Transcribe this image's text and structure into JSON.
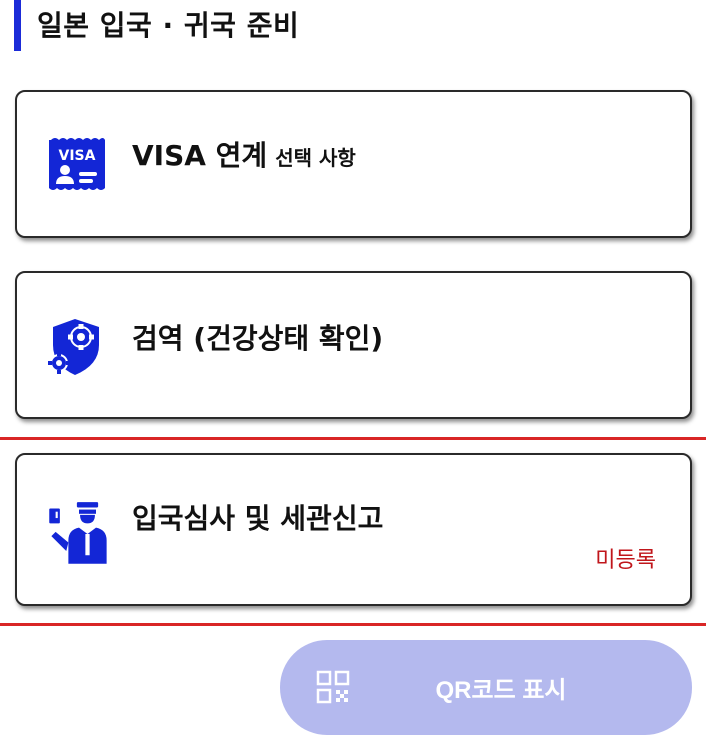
{
  "section": {
    "title": "일본 입국 · 귀국 준비"
  },
  "cards": [
    {
      "title": "VISA 연계",
      "subtitle": "선택 사항",
      "icon": "visa-card-icon",
      "icon_text": "VISA"
    },
    {
      "title": "검역 (건강상태 확인)",
      "icon": "health-shield-gear-icon"
    },
    {
      "title": "입국심사 및 세관신고",
      "status": "미등록",
      "icon": "immigration-officer-icon"
    }
  ],
  "qr_button": {
    "label": "QR코드 표시",
    "icon": "qr-code-icon"
  },
  "colors": {
    "accent": "#1b2bd8",
    "icon_blue": "#1326d6",
    "status_red": "#c0161b",
    "highlight_red": "#d92626",
    "qr_button_bg": "#b4b9ee"
  }
}
